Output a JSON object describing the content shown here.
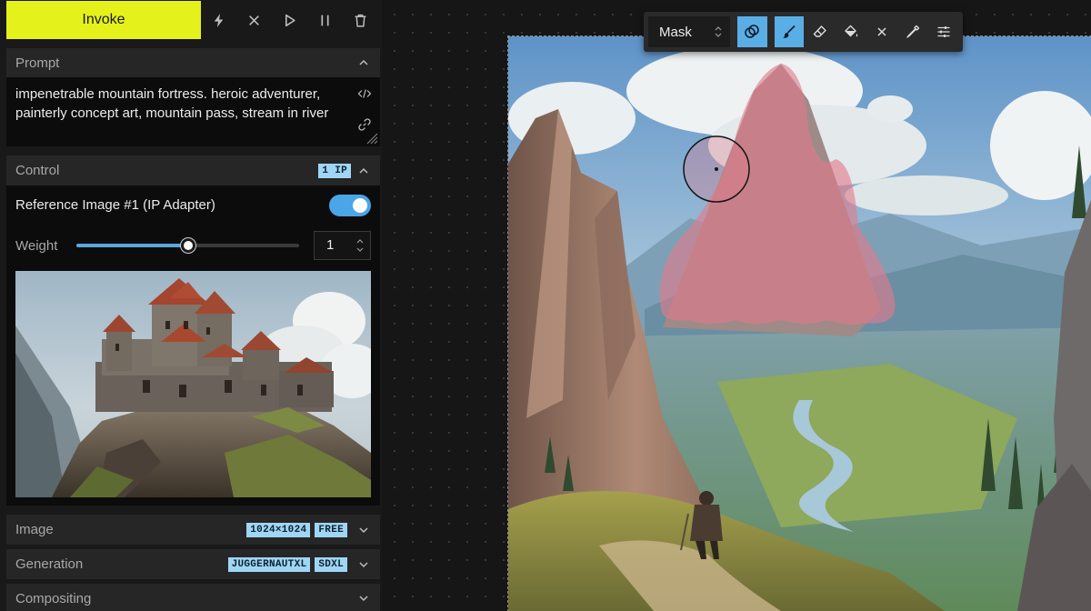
{
  "toolbar": {
    "invoke_label": "Invoke",
    "icons": [
      "lightning-icon",
      "close-icon",
      "play-icon",
      "pause-icon",
      "trash-icon"
    ]
  },
  "prompt": {
    "title": "Prompt",
    "text": "impenetrable mountain fortress. heroic adventurer, painterly concept art, mountain pass, stream in river"
  },
  "control": {
    "title": "Control",
    "badge": "1 IP",
    "reference_title": "Reference Image #1 (IP Adapter)",
    "enabled": true,
    "weight_label": "Weight",
    "weight_value": "1",
    "weight_fraction": 0.5
  },
  "image_section": {
    "title": "Image",
    "badges": [
      "1024×1024",
      "FREE"
    ]
  },
  "generation_section": {
    "title": "Generation",
    "badges": [
      "JUGGERNAUTXL",
      "SDXL"
    ]
  },
  "compositing_section": {
    "title": "Compositing"
  },
  "canvas_toolbar": {
    "mode": "Mask",
    "active_tools": [
      "mask-layers-icon",
      "brush-icon"
    ]
  },
  "colors": {
    "invoke": "#e4f11a",
    "accent": "#5aaee6",
    "badge": "#9ed6f4",
    "mask": "#e07a8a"
  }
}
